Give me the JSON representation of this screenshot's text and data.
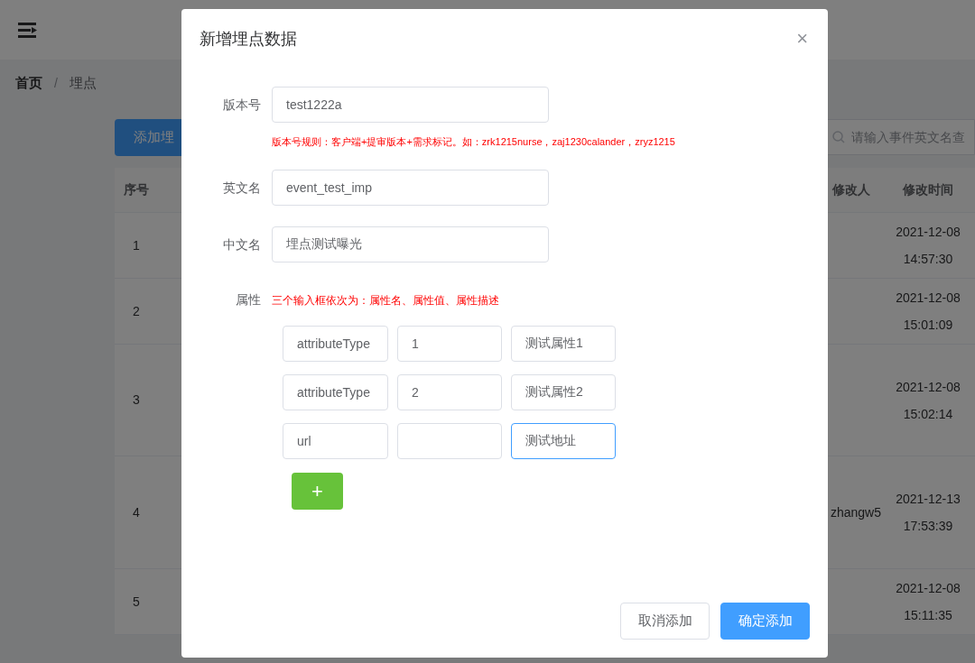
{
  "breadcrumb": [
    {
      "label": "首页",
      "current": false
    },
    {
      "label": "埋点",
      "current": true
    }
  ],
  "breadcrumb_separator": "/",
  "add_button": "添加埋",
  "search": {
    "placeholder": "请输入事件英文名查"
  },
  "table": {
    "columns": [
      "序号",
      "修改人",
      "修改时间"
    ],
    "rows": [
      {
        "index": "1",
        "modified_time": [
          "2021-12-08",
          "14:57:30"
        ]
      },
      {
        "index": "2",
        "modified_time": [
          "2021-12-08",
          "15:01:09"
        ]
      },
      {
        "index": "3",
        "modified_time": [
          "2021-12-08",
          "15:02:14"
        ]
      },
      {
        "index": "4",
        "modifier": "zhangw5",
        "modified_time": [
          "2021-12-13",
          "17:53:39"
        ]
      },
      {
        "index": "5",
        "modified_time": [
          "2021-12-08",
          "15:11:35"
        ]
      }
    ]
  },
  "dialog": {
    "title": "新增埋点数据",
    "close": "×",
    "fields": [
      {
        "label": "版本号",
        "value": "test1222a",
        "hint": "版本号规则：客户端+提审版本+需求标记。如：zrk1215nurse，zaj1230calander，zryz1215"
      },
      {
        "label": "英文名",
        "value": "event_test_imp"
      },
      {
        "label": "中文名",
        "value": "埋点测试曝光"
      }
    ],
    "attributes": {
      "label": "属性",
      "hint": "三个输入框依次为：属性名、属性值、属性描述",
      "rows": [
        {
          "name": "attributeType",
          "value": "1",
          "description": "测试属性1",
          "focused": false
        },
        {
          "name": "attributeType",
          "value": "2",
          "description": "测试属性2",
          "focused": false
        },
        {
          "name": "url",
          "description": "测试地址",
          "focused": true
        }
      ],
      "add": "+"
    },
    "buttons": [
      {
        "label": "取消添加",
        "kind": "secondary"
      },
      {
        "label": "确定添加",
        "kind": "primary"
      }
    ]
  }
}
